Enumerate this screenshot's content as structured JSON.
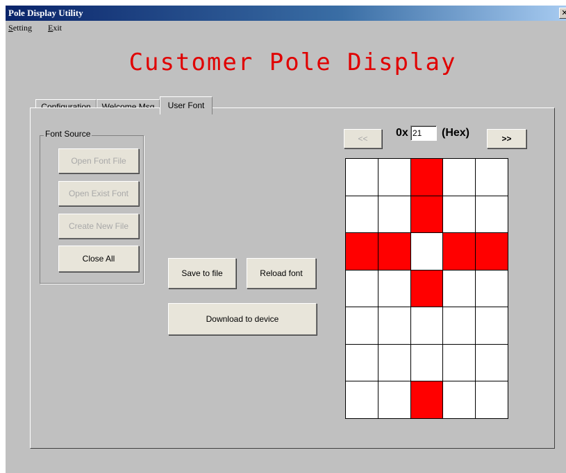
{
  "window": {
    "title": "Pole Display Utility",
    "close_glyph": "✕"
  },
  "menu": {
    "setting": {
      "hotkey": "S",
      "rest": "etting"
    },
    "exit": {
      "hotkey": "E",
      "rest": "xit"
    }
  },
  "heading": "Customer Pole Display",
  "tabs": [
    {
      "label": "Configuration"
    },
    {
      "label": "Welcome Msg"
    },
    {
      "label": "User Font"
    }
  ],
  "font_source": {
    "legend": "Font Source",
    "open_font_file": "Open Font File",
    "open_exist_font": "Open Exist Font",
    "create_new_file": "Create New File",
    "close_all": "Close All"
  },
  "actions": {
    "save_to_file": "Save to file",
    "reload_font": "Reload font",
    "download_to_device": "Download to device"
  },
  "char_nav": {
    "prev": "<<",
    "next": ">>",
    "prefix": "0x",
    "code": "21",
    "suffix": "(Hex)"
  },
  "font_grid": {
    "columns": 5,
    "rows": 7,
    "on_color": "#ff0000",
    "off_color": "#ffffff",
    "pixels": [
      [
        0,
        0,
        1,
        0,
        0
      ],
      [
        0,
        0,
        1,
        0,
        0
      ],
      [
        1,
        1,
        0,
        1,
        1
      ],
      [
        0,
        0,
        1,
        0,
        0
      ],
      [
        0,
        0,
        0,
        0,
        0
      ],
      [
        0,
        0,
        0,
        0,
        0
      ],
      [
        0,
        0,
        1,
        0,
        0
      ]
    ]
  },
  "colors": {
    "heading": "#e00000",
    "window_bg": "#c0c0c0",
    "titlebar": "#0a246a"
  }
}
